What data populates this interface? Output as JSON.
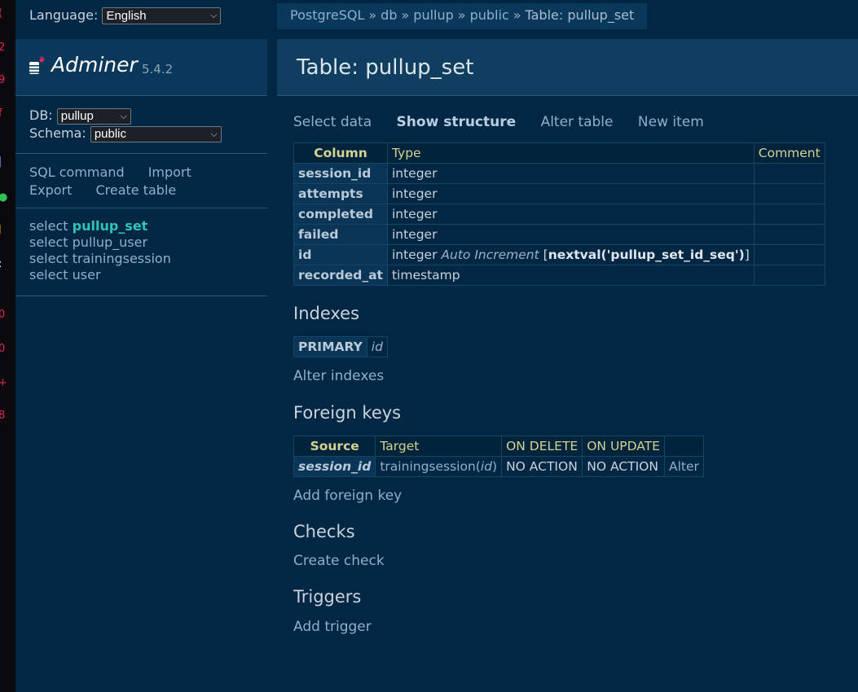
{
  "colors": {
    "background": "#022744",
    "header_bg": "#0f3e60",
    "link": "#8fb0cc",
    "active_table": "#2ec4b6",
    "table_header_text": "#d3d48f"
  },
  "sidebar": {
    "language_label": "Language:",
    "language_value": "English",
    "app_name": "Adminer",
    "app_version": "5.4.2",
    "db_label": "DB:",
    "db_value": "pullup",
    "schema_label": "Schema:",
    "schema_value": "public",
    "commands": {
      "sql_command": "SQL command",
      "import": "Import",
      "export": "Export",
      "create_table": "Create table"
    },
    "select_word": "select",
    "tables": [
      {
        "name": "pullup_set",
        "active": true
      },
      {
        "name": "pullup_user",
        "active": false
      },
      {
        "name": "trainingsession",
        "active": false
      },
      {
        "name": "user",
        "active": false
      }
    ]
  },
  "breadcrumb": {
    "items": [
      "PostgreSQL",
      "db",
      "pullup",
      "public"
    ],
    "separator": "»",
    "current": "Table: pullup_set"
  },
  "page": {
    "title": "Table: pullup_set",
    "actions": {
      "select_data": "Select data",
      "show_structure": "Show structure",
      "alter_table": "Alter table",
      "new_item": "New item"
    }
  },
  "structure": {
    "headers": [
      "Column",
      "Type",
      "Comment"
    ],
    "rows": [
      {
        "column": "session_id",
        "type": "integer",
        "comment": ""
      },
      {
        "column": "attempts",
        "type": "integer",
        "comment": ""
      },
      {
        "column": "completed",
        "type": "integer",
        "comment": ""
      },
      {
        "column": "failed",
        "type": "integer",
        "comment": ""
      },
      {
        "column": "id",
        "type": "integer",
        "extra": "Auto Increment",
        "default_open": "[",
        "default": "nextval('pullup_set_id_seq')",
        "default_close": "]",
        "comment": ""
      },
      {
        "column": "recorded_at",
        "type": "timestamp",
        "comment": ""
      }
    ]
  },
  "indexes": {
    "heading": "Indexes",
    "rows": [
      {
        "kind": "PRIMARY",
        "columns": "id"
      }
    ],
    "alter_link": "Alter indexes"
  },
  "foreign_keys": {
    "heading": "Foreign keys",
    "headers": [
      "Source",
      "Target",
      "ON DELETE",
      "ON UPDATE",
      ""
    ],
    "rows": [
      {
        "source": "session_id",
        "target_table": "trainingsession",
        "target_col": "id",
        "on_delete": "NO ACTION",
        "on_update": "NO ACTION",
        "alter": "Alter"
      }
    ],
    "add_link": "Add foreign key"
  },
  "checks": {
    "heading": "Checks",
    "create_link": "Create check"
  },
  "triggers": {
    "heading": "Triggers",
    "add_link": "Add trigger"
  }
}
